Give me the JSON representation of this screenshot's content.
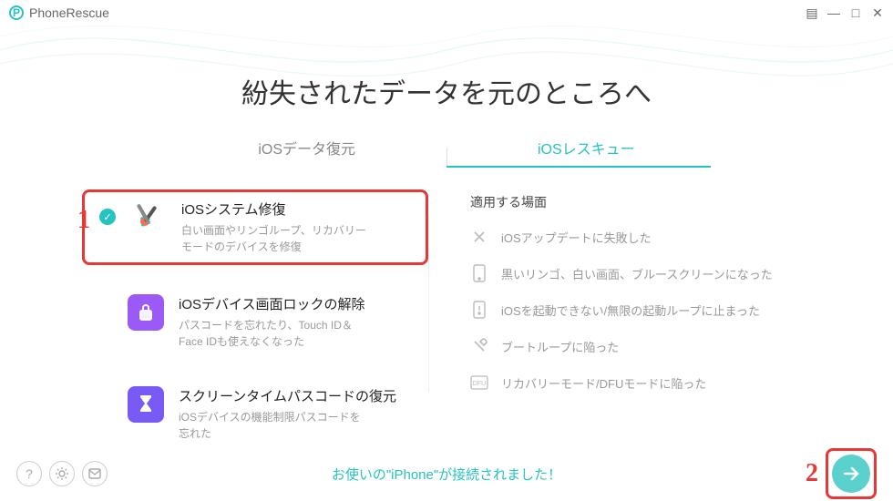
{
  "app": {
    "name": "PhoneRescue"
  },
  "hero": {
    "title": "紛失されたデータを元のところへ"
  },
  "tabs": {
    "data_recovery": "iOSデータ復元",
    "rescue": "iOSレスキュー"
  },
  "options": {
    "system_repair": {
      "title": "iOSシステム修復",
      "desc": "白い画面やリンゴループ、リカバリーモードのデバイスを修復"
    },
    "screen_unlock": {
      "title": "iOSデバイス画面ロックの解除",
      "desc": "パスコードを忘れたり、Touch ID＆Face IDも使えなくなった"
    },
    "screentime": {
      "title": "スクリーンタイムパスコードの復元",
      "desc": "iOSデバイスの機能制限パスコードを忘れた"
    }
  },
  "scenarios": {
    "heading": "適用する場面",
    "items": [
      "iOSアップデートに失敗した",
      "黒いリンゴ、白い画面、ブルースクリーンになった",
      "iOSを起動できない/無限の起動ループに止まった",
      "ブートループに陥った",
      "リカバリーモード/DFUモードに陥った"
    ]
  },
  "footer": {
    "status": "お使いの\"iPhone\"が接続されました！"
  },
  "annotations": {
    "one": "1",
    "two": "2"
  }
}
